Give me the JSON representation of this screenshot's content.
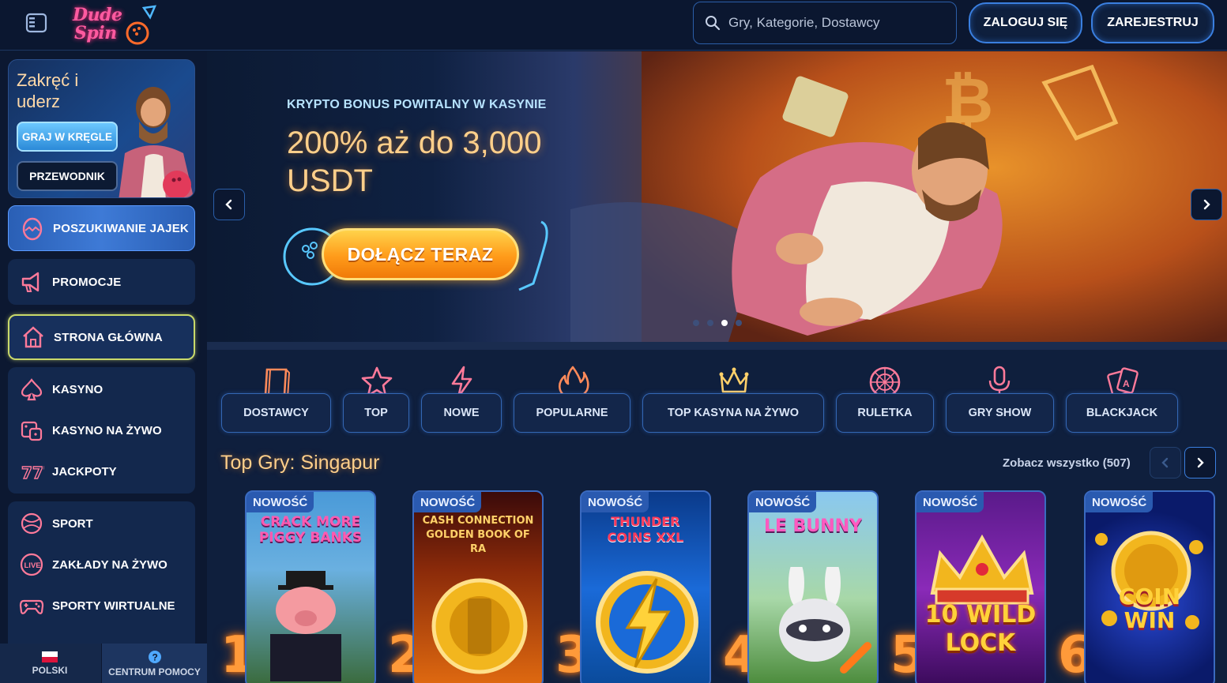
{
  "header": {
    "logo_line1": "Dude",
    "logo_line2": "Spin",
    "search_placeholder": "Gry, Kategorie, Dostawcy",
    "login_label": "ZALOGUJ SIĘ",
    "register_label": "ZAREJESTRUJ"
  },
  "sidebar": {
    "promo": {
      "title": "Zakręć i uderz",
      "bowling_button": "GRAJ W KRĘGLE",
      "guide_button": "PRZEWODNIK"
    },
    "egg_hunt": "POSZUKIWANIE JAJEK",
    "promotions": "PROMOCJE",
    "home": "STRONA GŁÓWNA",
    "casino_group": [
      "KASYNO",
      "KASYNO NA ŻYWO",
      "JACKPOTY"
    ],
    "sport_group": [
      "SPORT",
      "ZAKŁADY NA ŻYWO",
      "SPORTY WIRTUALNE"
    ],
    "footer": {
      "language": "POLSKI",
      "help": "CENTRUM POMOCY"
    }
  },
  "hero": {
    "kicker": "KRYPTO BONUS POWITALNY W KASYNIE",
    "title": "200% aż do 3,000 USDT",
    "cta": "DOŁĄCZ TERAZ",
    "slides": 4,
    "active_slide": 3
  },
  "categories": [
    "DOSTAWCY",
    "TOP",
    "NOWE",
    "POPULARNE",
    "TOP KASYNA NA ŻYWO",
    "RULETKA",
    "GRY SHOW",
    "BLACKJACK"
  ],
  "top_games": {
    "title": "Top Gry: Singapur",
    "see_all": "Zobacz wszystko (507)",
    "badge": "NOWOŚĆ",
    "games": [
      {
        "rank": "1",
        "name": "CRACK MORE PIGGY BANKS"
      },
      {
        "rank": "2",
        "name": "CASH CONNECTION GOLDEN BOOK OF RA"
      },
      {
        "rank": "3",
        "name": "THUNDER COINS XXL"
      },
      {
        "rank": "4",
        "name": "LE BUNNY"
      },
      {
        "rank": "5",
        "name": "10 WILD LOCK"
      },
      {
        "rank": "6",
        "name": "COIN WIN"
      }
    ]
  },
  "colors": {
    "background": "#0d1a33",
    "accent_orange": "#ffcf8a",
    "accent_blue": "#3a7fe0",
    "cta_orange": "#ff9b1a"
  }
}
